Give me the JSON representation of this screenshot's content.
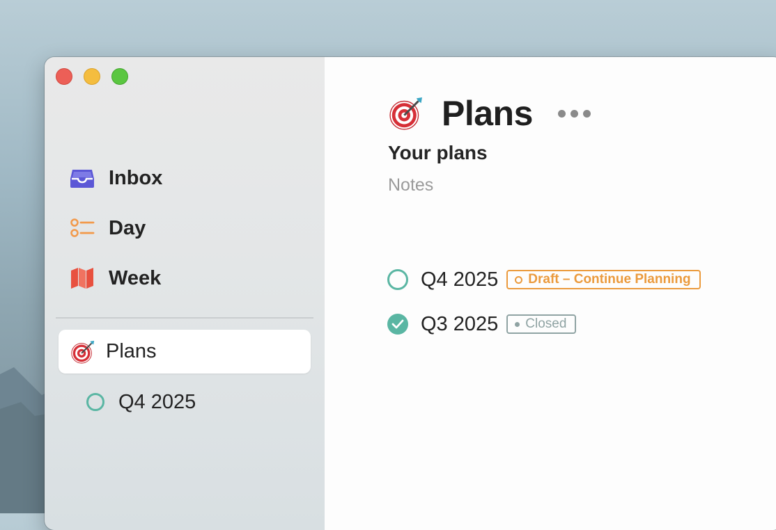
{
  "window": {
    "controls": [
      "close",
      "minimize",
      "zoom"
    ]
  },
  "sidebar": {
    "items": [
      {
        "label": "Inbox",
        "icon": "inbox-icon",
        "color": "#5b57d6"
      },
      {
        "label": "Day",
        "icon": "checklist-icon",
        "color": "#f2994a"
      },
      {
        "label": "Week",
        "icon": "map-icon",
        "color": "#e8513f"
      }
    ],
    "selected": {
      "label": "Plans",
      "icon": "dart-target-icon"
    },
    "sub_items": [
      {
        "label": "Q4 2025",
        "status": "open"
      }
    ]
  },
  "main": {
    "title": "Plans",
    "title_icon": "dart-target-icon",
    "subtitle": "Your plans",
    "notes_placeholder": "Notes",
    "tasks": [
      {
        "name": "Q4 2025",
        "done": false,
        "badge": "Draft – Continue Planning",
        "badge_color": "#eb9a3c"
      },
      {
        "name": "Q3 2025",
        "done": true,
        "badge": "Closed",
        "badge_color": "#8fa3a3"
      }
    ]
  },
  "colors": {
    "accent_teal": "#5ab6a3",
    "draft_orange": "#eb9a3c",
    "closed_gray": "#8fa3a3"
  }
}
